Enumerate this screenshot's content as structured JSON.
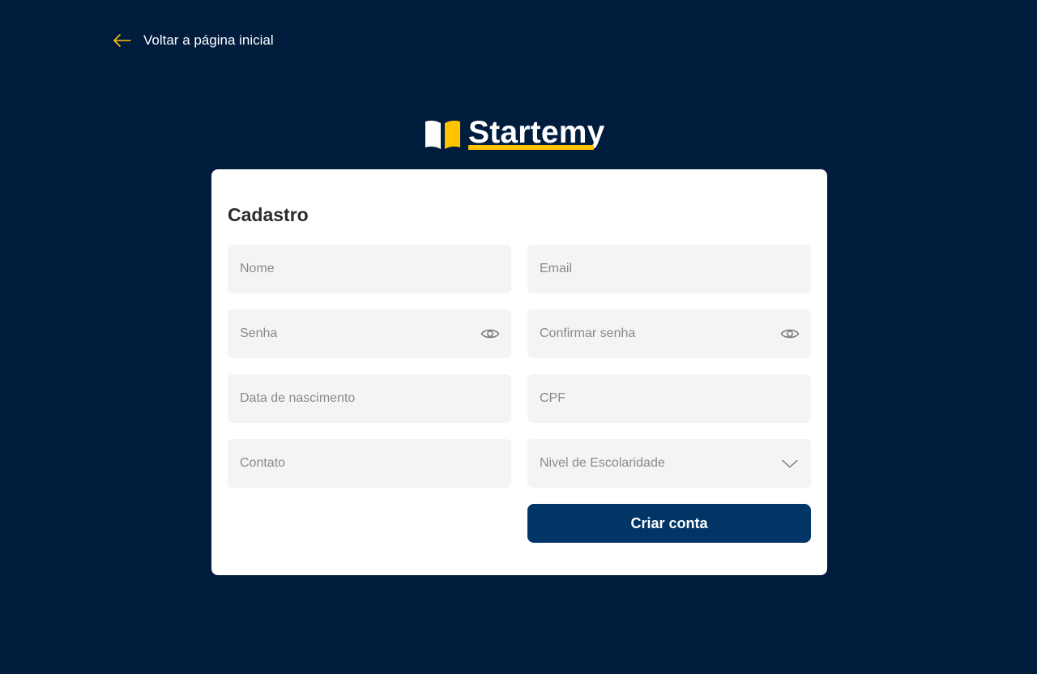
{
  "back_link": {
    "label": "Voltar a página inicial",
    "icon": "arrow-left-icon",
    "icon_color": "#ffc300"
  },
  "brand": {
    "name": "Startemy",
    "icon": "open-book-icon",
    "accent_color": "#ffc300"
  },
  "form": {
    "title": "Cadastro",
    "fields": {
      "nome": {
        "placeholder": "Nome",
        "value": ""
      },
      "email": {
        "placeholder": "Email",
        "value": ""
      },
      "senha": {
        "placeholder": "Senha",
        "value": "",
        "icon": "eye-icon"
      },
      "confirmar_senha": {
        "placeholder": "Confirmar senha",
        "value": "",
        "icon": "eye-icon"
      },
      "data_nascimento": {
        "placeholder": "Data de nascimento",
        "value": ""
      },
      "cpf": {
        "placeholder": "CPF",
        "value": ""
      },
      "contato": {
        "placeholder": "Contato",
        "value": ""
      },
      "escolaridade": {
        "placeholder": "Nivel de Escolaridade",
        "icon": "chevron-down-icon"
      }
    },
    "submit_label": "Criar conta"
  },
  "colors": {
    "page_background": "#001d3d",
    "card_background": "#ffffff",
    "field_background": "#f4f4f4",
    "button_background": "#003566",
    "accent": "#ffc300"
  }
}
